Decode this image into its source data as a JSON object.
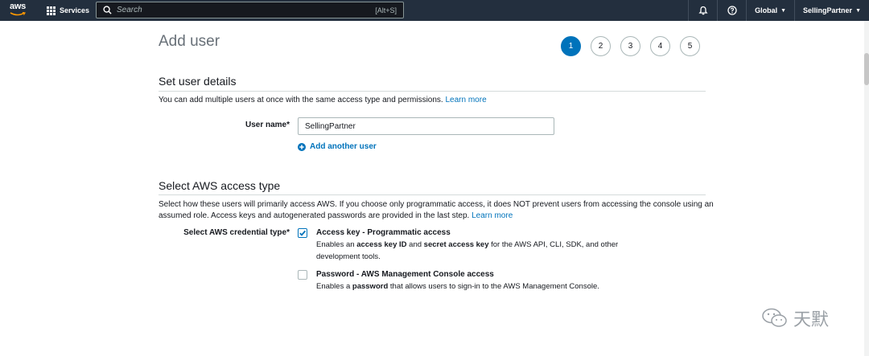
{
  "topnav": {
    "logo_text": "aws",
    "services_label": "Services",
    "search_placeholder": "Search",
    "search_shortcut": "[Alt+S]",
    "region_label": "Global",
    "account_label": "SellingPartner"
  },
  "page": {
    "title": "Add user",
    "steps": [
      "1",
      "2",
      "3",
      "4",
      "5"
    ],
    "active_step": "1"
  },
  "user_details": {
    "heading": "Set user details",
    "description": "You can add multiple users at once with the same access type and permissions.",
    "learn_more": "Learn more",
    "user_name_label": "User name*",
    "user_name_value": "SellingPartner",
    "add_another": "Add another user"
  },
  "access_type": {
    "heading": "Select AWS access type",
    "description": "Select how these users will primarily access AWS. If you choose only programmatic access, it does NOT prevent users from accessing the console using an assumed role. Access keys and autogenerated passwords are provided in the last step.",
    "learn_more": "Learn more",
    "credential_label": "Select AWS credential type*",
    "options": [
      {
        "title": "Access key - Programmatic access",
        "desc_parts": [
          "Enables an ",
          "access key ID",
          " and ",
          "secret access key",
          " for the AWS API, CLI, SDK, and other development tools."
        ],
        "checked": true
      },
      {
        "title": "Password - AWS Management Console access",
        "desc_parts": [
          "Enables a ",
          "password",
          " that allows users to sign-in to the AWS Management Console."
        ],
        "checked": false
      }
    ]
  },
  "watermark": {
    "text": "天默"
  },
  "colors": {
    "nav_bg": "#232f3e",
    "accent": "#0073bb",
    "title_gray": "#687078"
  }
}
